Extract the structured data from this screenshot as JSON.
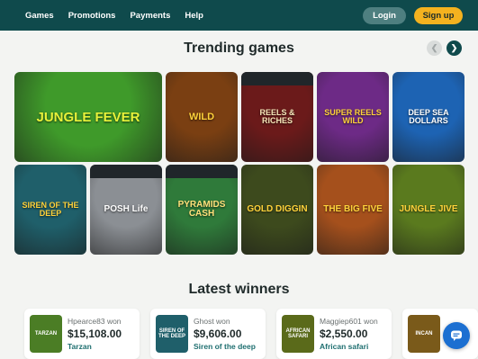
{
  "header": {
    "nav": [
      "Games",
      "Promotions",
      "Payments",
      "Help"
    ],
    "login_label": "Login",
    "signup_label": "Sign up"
  },
  "trending": {
    "title": "Trending games",
    "prev_icon": "chevron-left-icon",
    "next_icon": "chevron-right-icon",
    "games": [
      {
        "id": "jungle-fever",
        "name": "JUNGLE FEVER",
        "bg": "#3f9a2a",
        "color": "#e8f23a"
      },
      {
        "id": "wild-lion",
        "name": "WILD",
        "bg": "#7a3f12",
        "color": "#ffd23a"
      },
      {
        "id": "reels-riches",
        "name": "REELS & RICHES",
        "bg": "#6b1a1a",
        "color": "#f5e6b8"
      },
      {
        "id": "super-reels-wild",
        "name": "SUPER REELS WILD",
        "bg": "#6d2a86",
        "color": "#ffd23a"
      },
      {
        "id": "deep-sea-dollars",
        "name": "DEEP SEA DOLLARS",
        "bg": "#1d63b3",
        "color": "#ffffff"
      },
      {
        "id": "siren-of-the-deep",
        "name": "SIREN OF THE DEEP",
        "bg": "#1f5f6a",
        "color": "#ffd23a"
      },
      {
        "id": "posh-life",
        "name": "POSH Life",
        "bg": "#8b8f94",
        "color": "#ffffff"
      },
      {
        "id": "pyramids-cash",
        "name": "PYRAMIDS CASH",
        "bg": "#2f7a3a",
        "color": "#ffe07a"
      },
      {
        "id": "gold-diggin",
        "name": "GOLD DIGGIN",
        "bg": "#3d4a1d",
        "color": "#ffd23a"
      },
      {
        "id": "big-five",
        "name": "THE BIG FIVE",
        "bg": "#a5501c",
        "color": "#ffd23a"
      },
      {
        "id": "jungle-jive",
        "name": "JUNGLE JIVE",
        "bg": "#5a7a1e",
        "color": "#ffd23a"
      }
    ]
  },
  "winners": {
    "title": "Latest winners",
    "items": [
      {
        "user": "Hpearce83 won",
        "amount": "$15,108.00",
        "game": "Tarzan",
        "thumb_label": "TARZAN",
        "thumb_bg": "#4b7d25"
      },
      {
        "user": "Ghost won",
        "amount": "$9,606.00",
        "game": "Siren of the deep",
        "thumb_label": "SIREN OF THE DEEP",
        "thumb_bg": "#1f5f6a"
      },
      {
        "user": "Maggiep601 won",
        "amount": "$2,550.00",
        "game": "African safari",
        "thumb_label": "AFRICAN SAFARI",
        "thumb_bg": "#5a6a1a"
      },
      {
        "user": "",
        "amount": "",
        "game": "",
        "thumb_label": "INCAN",
        "thumb_bg": "#7a5a1a"
      }
    ]
  },
  "chat_icon": "chat-bubble-icon"
}
